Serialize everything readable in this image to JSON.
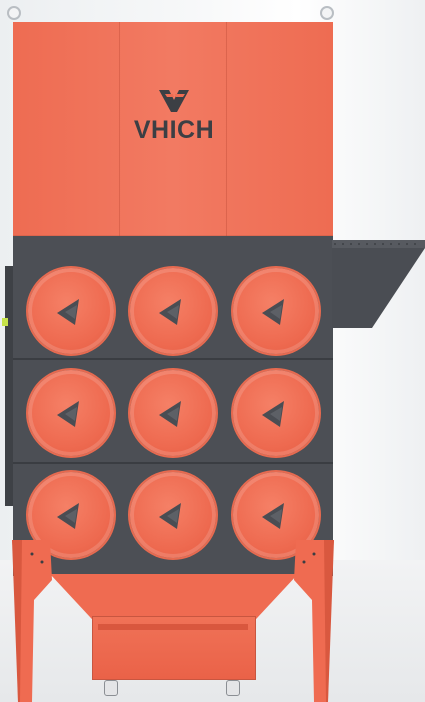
{
  "brand": {
    "logo_text": "VHICH",
    "logo_icon": "vhich-logo-mark-icon"
  },
  "product": {
    "panel_color": "#ee6c52",
    "body_color": "#4c4f55",
    "filter_rows": 3,
    "filter_columns": 3
  }
}
